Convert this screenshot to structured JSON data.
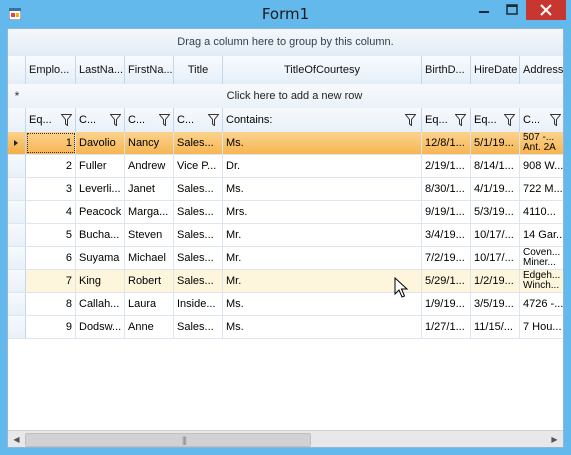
{
  "window": {
    "title": "Form1"
  },
  "grid": {
    "group_panel_text": "Drag a column here to group by this column.",
    "new_row_text": "Click here to add a new row",
    "new_row_symbol": "*",
    "columns": [
      "Emplo...",
      "LastNa...",
      "FirstNa...",
      "Title",
      "TitleOfCourtesy",
      "BirthD...",
      "HireDate",
      "Address"
    ],
    "filters": [
      "Eq...",
      "C...",
      "C...",
      "C...",
      "Contains:",
      "Eq...",
      "Eq...",
      "C..."
    ],
    "rows": [
      {
        "id": "1",
        "last": "Davolio",
        "first": "Nancy",
        "title": "Sales...",
        "courtesy": "Ms.",
        "birth": "12/8/1...",
        "hire": "5/1/19...",
        "address": "507 -...\nAnt. 2A"
      },
      {
        "id": "2",
        "last": "Fuller",
        "first": "Andrew",
        "title": "Vice P...",
        "courtesy": "Dr.",
        "birth": "2/19/1...",
        "hire": "8/14/1...",
        "address": "908 W..."
      },
      {
        "id": "3",
        "last": "Leverli...",
        "first": "Janet",
        "title": "Sales...",
        "courtesy": "Ms.",
        "birth": "8/30/1...",
        "hire": "4/1/19...",
        "address": "722 M..."
      },
      {
        "id": "4",
        "last": "Peacock",
        "first": "Marga...",
        "title": "Sales...",
        "courtesy": "Mrs.",
        "birth": "9/19/1...",
        "hire": "5/3/19...",
        "address": "4110..."
      },
      {
        "id": "5",
        "last": "Bucha...",
        "first": "Steven",
        "title": "Sales...",
        "courtesy": "Mr.",
        "birth": "3/4/19...",
        "hire": "10/17/...",
        "address": "14 Gar..."
      },
      {
        "id": "6",
        "last": "Suyama",
        "first": "Michael",
        "title": "Sales...",
        "courtesy": "Mr.",
        "birth": "7/2/19...",
        "hire": "10/17/...",
        "address": "Coven...\nMiner..."
      },
      {
        "id": "7",
        "last": "King",
        "first": "Robert",
        "title": "Sales...",
        "courtesy": "Mr.",
        "birth": "5/29/1...",
        "hire": "1/2/19...",
        "address": "Edgeh...\nWinch..."
      },
      {
        "id": "8",
        "last": "Callah...",
        "first": "Laura",
        "title": "Inside...",
        "courtesy": "Ms.",
        "birth": "1/9/19...",
        "hire": "3/5/19...",
        "address": "4726 -..."
      },
      {
        "id": "9",
        "last": "Dodsw...",
        "first": "Anne",
        "title": "Sales...",
        "courtesy": "Ms.",
        "birth": "1/27/1...",
        "hire": "11/15/...",
        "address": "7 Hou..."
      }
    ]
  },
  "colors": {
    "current_row": "#f7b552",
    "hover_row": "#fdf5dc",
    "title_bar": "#63b8ec",
    "close_button": "#c7372f"
  }
}
